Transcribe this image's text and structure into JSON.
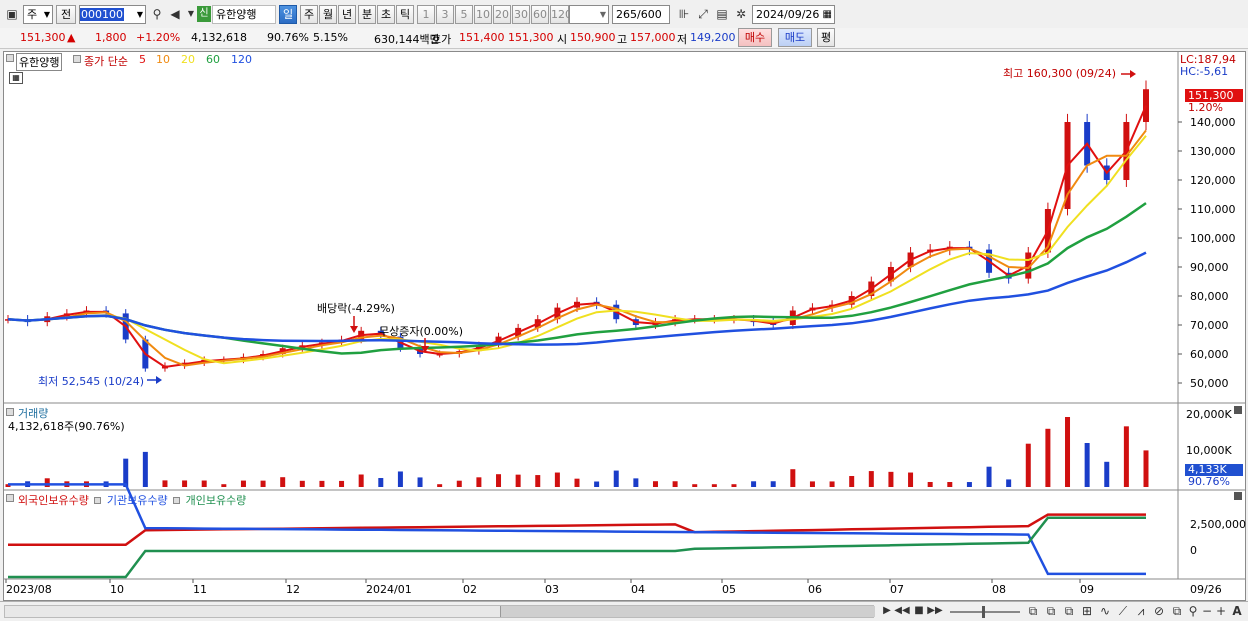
{
  "toolbar": {
    "period_select": "주",
    "prev_label": "전",
    "code_value": "000100",
    "new_badge": "신",
    "stock_name": "유한양행",
    "periods": [
      "일",
      "주",
      "월",
      "년",
      "분",
      "초",
      "틱"
    ],
    "active_period": "일",
    "intervals": [
      "1",
      "3",
      "5",
      "10",
      "20",
      "30",
      "60",
      "120"
    ],
    "count_value": "265",
    "count_total": "/600",
    "date_value": "2024/09/26"
  },
  "quote": {
    "price": "151,300",
    "arrow": "▲",
    "change": "1,800",
    "change_pct": "+1.20%",
    "volume": "4,132,618",
    "vol_ratio": "90.76%",
    "turnover": "5.15%",
    "amount": "630,144백만",
    "ask_label": "호가",
    "ask1": "151,400",
    "ask2": "151,300",
    "open_label": "시",
    "open": "150,900",
    "high_label": "고",
    "high": "157,000",
    "low_label": "저",
    "low": "149,200",
    "buy_label": "매수",
    "sell_label": "매도",
    "eval_label": "평"
  },
  "price_panel": {
    "name_tag": "유한양행",
    "legend_prefix": "종가 단순",
    "ma_labels": [
      "5",
      "10",
      "20",
      "60",
      "120"
    ],
    "ma_colors": [
      "#e01010",
      "#f08a10",
      "#f0e020",
      "#20a040",
      "#2050e0"
    ],
    "lc_label": "LC:187,94",
    "hc_label": "HC:-5,61",
    "current_tag": "151,300",
    "current_pct": "1.20%",
    "y_ticks": [
      "140,000",
      "130,000",
      "120,000",
      "110,000",
      "100,000",
      "90,000",
      "80,000",
      "70,000",
      "60,000",
      "50,000"
    ],
    "high_note": "최고 160,300 (09/24)",
    "low_note": "최저 52,545 (10/24)",
    "dividend_note": "배당락(-4.29%)",
    "bonus_note": "무상증자(0.00%)"
  },
  "volume_panel": {
    "title": "거래량",
    "value_text": "4,132,618주(90.76%)",
    "y_ticks": [
      "20,000K",
      "10,000K"
    ],
    "current_tag": "4,133K",
    "current_pct": "90.76%"
  },
  "holding_panel": {
    "legend": [
      "외국인보유수량",
      "기관보유수량",
      "개인보유수량"
    ],
    "legend_colors": [
      "#d01010",
      "#2050e0",
      "#209050"
    ],
    "y_ticks": [
      "2,500,000",
      "0"
    ]
  },
  "x_axis": [
    "2023/08",
    "10",
    "11",
    "12",
    "2024/01",
    "02",
    "03",
    "04",
    "05",
    "06",
    "07",
    "08",
    "09",
    "09/26"
  ],
  "chart_data": {
    "type": "line",
    "series": [
      {
        "name": "종가 단순 5",
        "values": [
          72000,
          71000,
          73000,
          74000,
          75000,
          74000,
          65000,
          55000,
          56000,
          57000,
          58000,
          58000,
          59000,
          60000,
          62000,
          63000,
          64000,
          65000,
          68000,
          66000,
          62000,
          60000,
          60000,
          61000,
          63000,
          66000,
          69000,
          72000,
          76000,
          78000,
          77000,
          72000,
          70000,
          71000,
          72000,
          72000,
          72000,
          72000,
          71000,
          70000,
          75000,
          76000,
          77000,
          80000,
          85000,
          90000,
          95000,
          96000,
          97000,
          96000,
          88000,
          86000,
          95000,
          110000,
          140000,
          125000,
          120000,
          140000,
          151300
        ]
      },
      {
        "name": "거래량 20,000K",
        "values": [
          20000
        ]
      }
    ]
  }
}
